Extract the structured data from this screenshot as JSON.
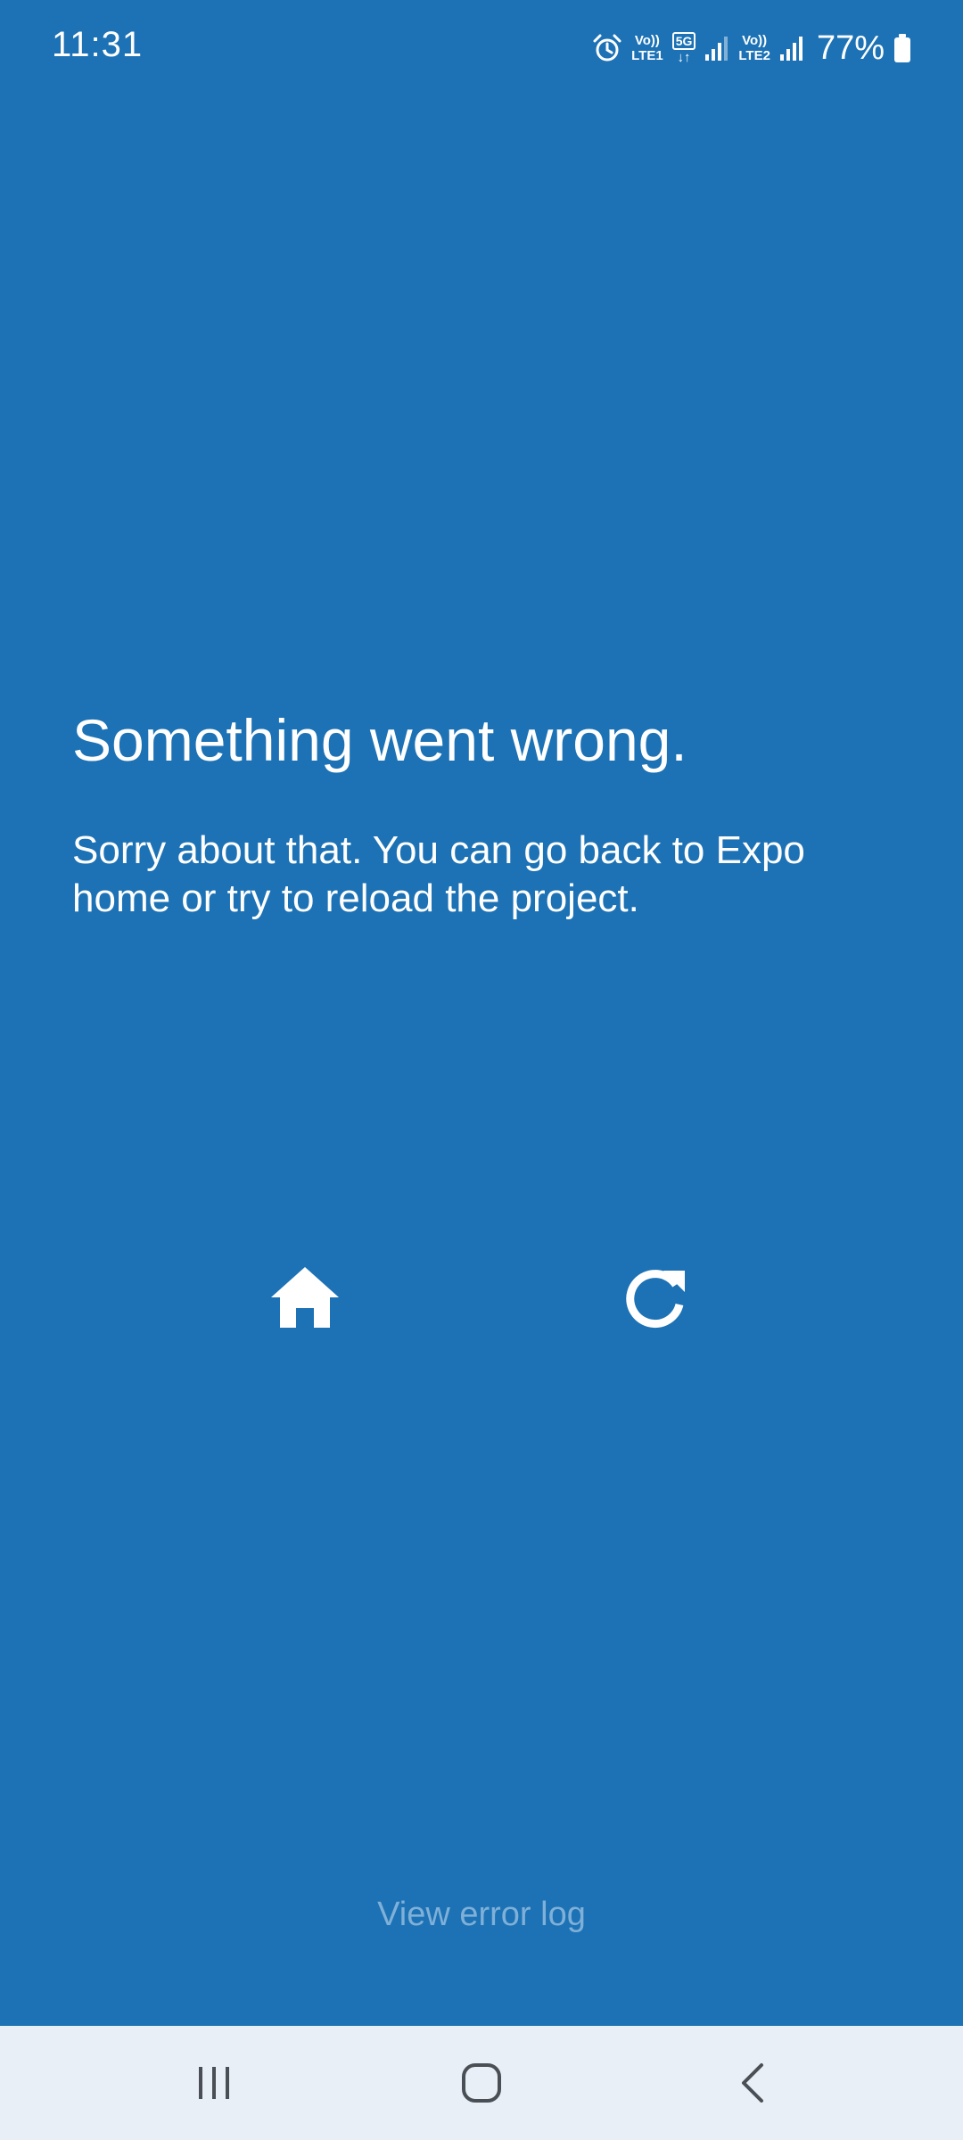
{
  "status_bar": {
    "time": "11:31",
    "sim1_top": "Vo))",
    "sim1_bottom": "LTE1",
    "network_badge": "5G",
    "sim2_top": "Vo))",
    "sim2_bottom": "LTE2",
    "battery": "77%"
  },
  "error": {
    "title": "Something went wrong.",
    "message": "Sorry about that. You can go back to Expo home or try to reload the project."
  },
  "actions": {
    "home_icon": "home-icon",
    "reload_icon": "reload-icon"
  },
  "footer": {
    "view_error_log": "View error log"
  },
  "colors": {
    "background": "#1c72b5",
    "text": "#ffffff",
    "link_muted": "#7fb0d8",
    "nav_bar": "#e9eff6"
  }
}
